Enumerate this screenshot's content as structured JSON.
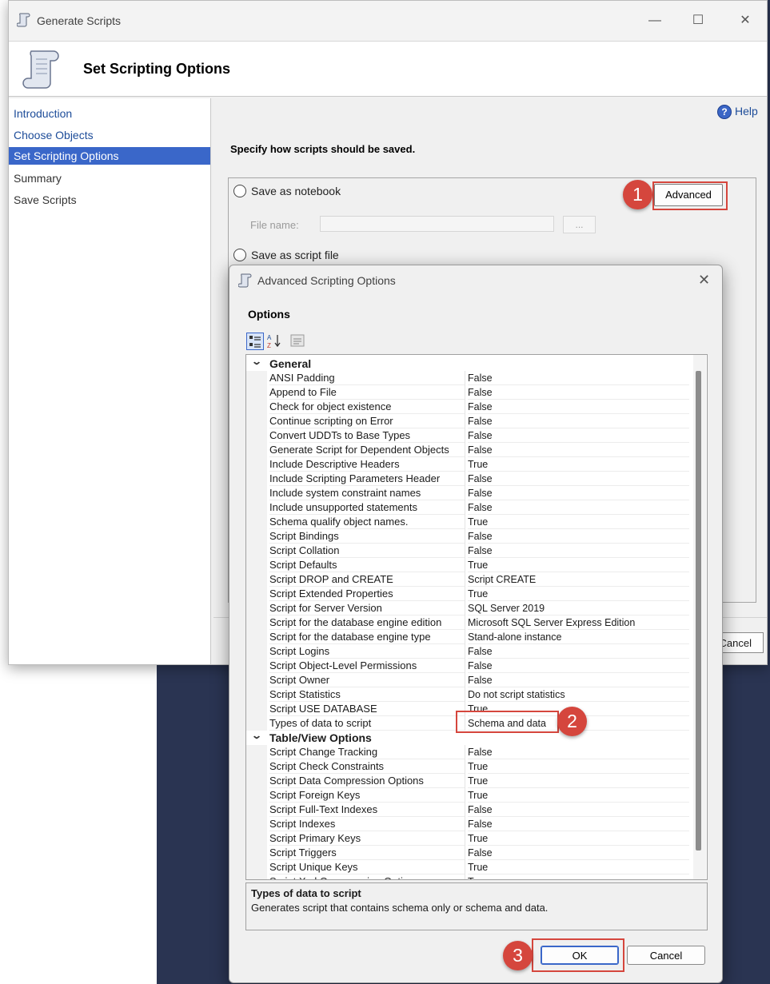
{
  "window": {
    "title": "Generate Scripts",
    "minimize_glyph": "—",
    "maximize_glyph": "☐",
    "close_glyph": "✕",
    "icon": "scroll-icon"
  },
  "header": {
    "title": "Set Scripting Options",
    "icon": "scroll-icon"
  },
  "nav": {
    "items": [
      {
        "label": "Introduction"
      },
      {
        "label": "Choose Objects"
      },
      {
        "label": "Set Scripting Options"
      },
      {
        "label": "Summary"
      },
      {
        "label": "Save Scripts"
      }
    ]
  },
  "main": {
    "help_label": "Help",
    "help_glyph": "?",
    "heading": "Specify how scripts should be saved.",
    "save_notebook_label": "Save as notebook",
    "file_name_label": "File name:",
    "browse_label": "...",
    "advanced_label": "Advanced",
    "save_script_label": "Save as script file",
    "cancel_label": "Cancel"
  },
  "dialog": {
    "title": "Advanced Scripting Options",
    "close_glyph": "✕",
    "options_label": "Options",
    "categories": [
      {
        "name": "General",
        "rows": [
          {
            "name": "ANSI Padding",
            "value": "False"
          },
          {
            "name": "Append to File",
            "value": "False"
          },
          {
            "name": "Check for object existence",
            "value": "False"
          },
          {
            "name": "Continue scripting on Error",
            "value": "False"
          },
          {
            "name": "Convert UDDTs to Base Types",
            "value": "False"
          },
          {
            "name": "Generate Script for Dependent Objects",
            "value": "False"
          },
          {
            "name": "Include Descriptive Headers",
            "value": "True"
          },
          {
            "name": "Include Scripting Parameters Header",
            "value": "False"
          },
          {
            "name": "Include system constraint names",
            "value": "False"
          },
          {
            "name": "Include unsupported statements",
            "value": "False"
          },
          {
            "name": "Schema qualify object names.",
            "value": "True"
          },
          {
            "name": "Script Bindings",
            "value": "False"
          },
          {
            "name": "Script Collation",
            "value": "False"
          },
          {
            "name": "Script Defaults",
            "value": "True"
          },
          {
            "name": "Script DROP and CREATE",
            "value": "Script CREATE"
          },
          {
            "name": "Script Extended Properties",
            "value": "True"
          },
          {
            "name": "Script for Server Version",
            "value": "SQL Server 2019"
          },
          {
            "name": "Script for the database engine edition",
            "value": "Microsoft SQL Server Express Edition"
          },
          {
            "name": "Script for the database engine type",
            "value": "Stand-alone instance"
          },
          {
            "name": "Script Logins",
            "value": "False"
          },
          {
            "name": "Script Object-Level Permissions",
            "value": "False"
          },
          {
            "name": "Script Owner",
            "value": "False"
          },
          {
            "name": "Script Statistics",
            "value": "Do not script statistics"
          },
          {
            "name": "Script USE DATABASE",
            "value": "True"
          },
          {
            "name": "Types of data to script",
            "value": "Schema and data"
          }
        ]
      },
      {
        "name": "Table/View Options",
        "rows": [
          {
            "name": "Script Change Tracking",
            "value": "False"
          },
          {
            "name": "Script Check Constraints",
            "value": "True"
          },
          {
            "name": "Script Data Compression Options",
            "value": "True"
          },
          {
            "name": "Script Foreign Keys",
            "value": "True"
          },
          {
            "name": "Script Full-Text Indexes",
            "value": "False"
          },
          {
            "name": "Script Indexes",
            "value": "False"
          },
          {
            "name": "Script Primary Keys",
            "value": "True"
          },
          {
            "name": "Script Triggers",
            "value": "False"
          },
          {
            "name": "Script Unique Keys",
            "value": "True"
          },
          {
            "name": "Script Xml Compression Options",
            "value": "True"
          }
        ]
      }
    ],
    "description": {
      "title": "Types of data to script",
      "text": "Generates script that contains schema only or schema and data."
    },
    "ok_label": "OK",
    "cancel_label": "Cancel"
  },
  "annotations": {
    "step1": "1",
    "step2": "2",
    "step3": "3",
    "color": "#d5463d"
  }
}
